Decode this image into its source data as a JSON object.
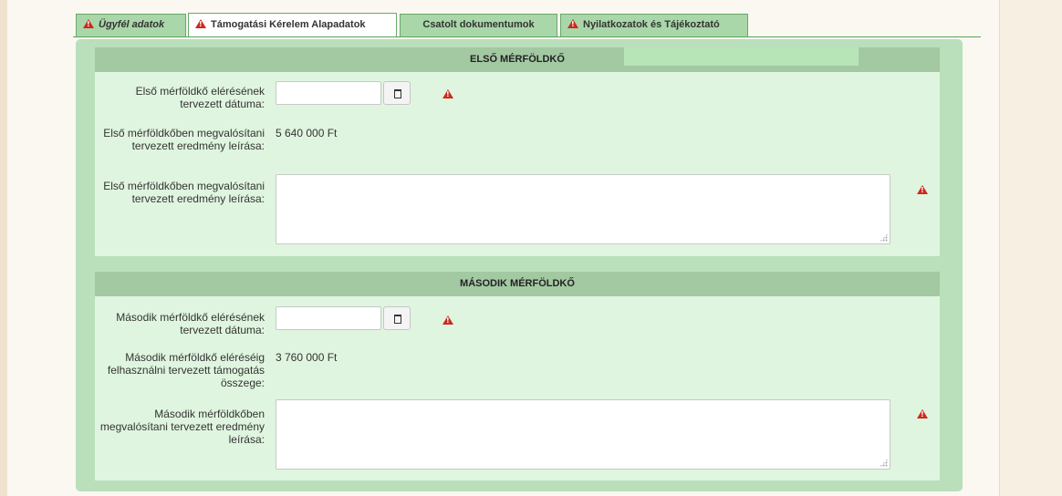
{
  "tabs": [
    {
      "label": "Ügyfél adatok",
      "warning": true
    },
    {
      "label": "Támogatási Kérelem Alapadatok",
      "warning": true,
      "active": true
    },
    {
      "label": "Csatolt dokumentumok",
      "warning": false
    },
    {
      "label": "Nyilatkozatok és Tájékoztató",
      "warning": true
    }
  ],
  "milestone1": {
    "title": "ELSŐ MÉRFÖLDKŐ",
    "date_label": "Első mérföldkő elérésének tervezett dátuma:",
    "date_value": "",
    "amount_label": "Első mérföldkőben megvalósítani tervezett eredmény leírása:",
    "amount_value": "5 640 000  Ft",
    "description_label": "Első mérföldkőben megvalósítani tervezett eredmény leírása:",
    "description_value": ""
  },
  "milestone2": {
    "title": "MÁSODIK MÉRFÖLDKŐ",
    "date_label": "Második mérföldkő elérésének tervezett dátuma:",
    "date_value": "",
    "amount_label": "Második mérföldkő eléréséig felhasználni tervezett támogatás összege:",
    "amount_value": "3 760 000  Ft",
    "description_label": "Második mérföldkőben megvalósítani tervezett eredmény leírása:",
    "description_value": ""
  },
  "icons": {
    "warning": "warning-icon",
    "calendar": "calendar-icon",
    "resize": "resize-grip-icon"
  },
  "colors": {
    "tab_bg": "#a9d7a9",
    "panel_bg": "#b9dfbb",
    "section_bg": "#dff5df",
    "section_header_bg": "#a3c9a3",
    "warning": "#cc2a1e"
  }
}
